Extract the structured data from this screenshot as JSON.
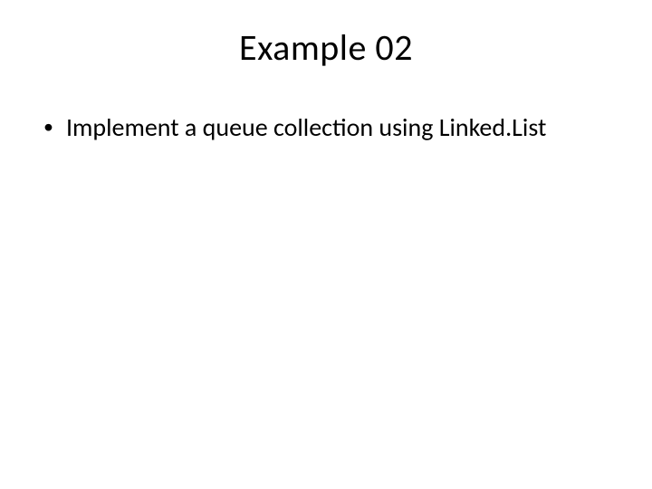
{
  "slide": {
    "title": "Example 02",
    "bullets": [
      {
        "text": "Implement a queue collection using Linked.List"
      }
    ]
  }
}
